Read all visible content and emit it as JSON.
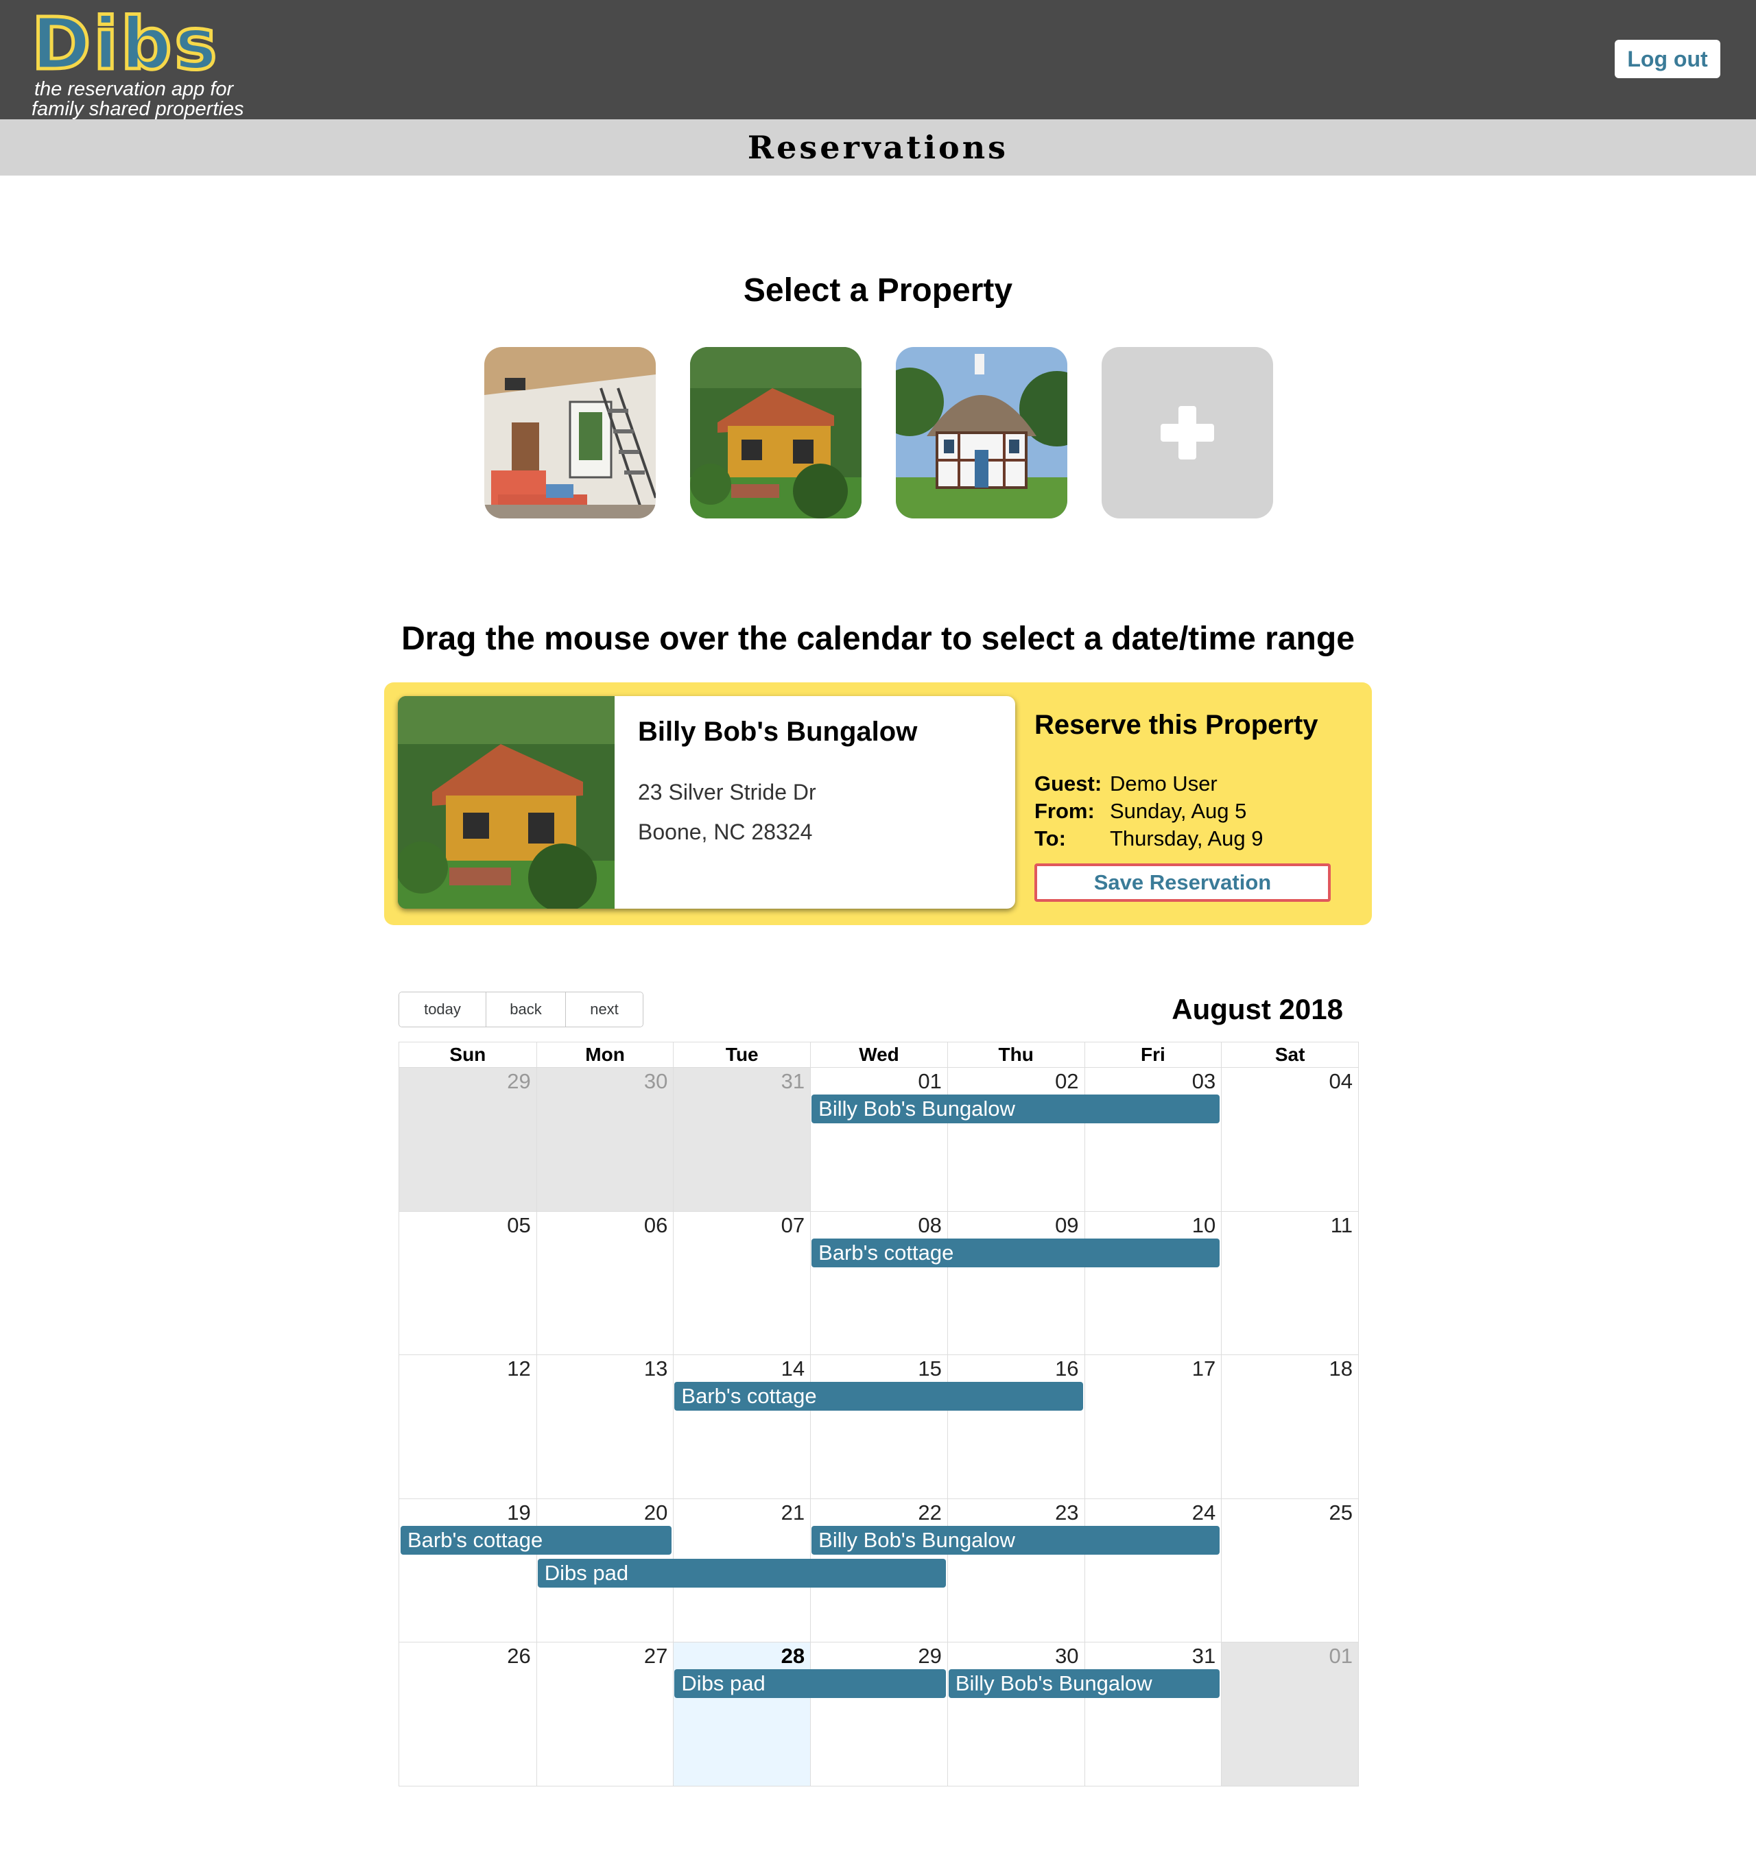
{
  "header": {
    "logo_text": "Dibs",
    "tagline_1": "the reservation app for",
    "tagline_2": "family shared properties",
    "logout_label": "Log out"
  },
  "page_title": "Reservations",
  "select_heading": "Select a Property",
  "drag_heading": "Drag the mouse over the calendar to select a date/time range",
  "selected_property": {
    "name": "Billy Bob's Bungalow",
    "address_1": "23 Silver Stride Dr",
    "address_2": "Boone, NC 28324"
  },
  "reserve": {
    "title": "Reserve this Property",
    "guest_label": "Guest:",
    "guest_value": "Demo User",
    "from_label": "From:",
    "from_value": "Sunday, Aug 5",
    "to_label": "To:",
    "to_value": "Thursday, Aug 9",
    "save_label": "Save Reservation"
  },
  "calendar": {
    "toolbar": {
      "today": "today",
      "back": "back",
      "next": "next"
    },
    "month_label": "August 2018",
    "weekdays": [
      "Sun",
      "Mon",
      "Tue",
      "Wed",
      "Thu",
      "Fri",
      "Sat"
    ],
    "weeks": [
      [
        {
          "d": "29",
          "off": true
        },
        {
          "d": "30",
          "off": true
        },
        {
          "d": "31",
          "off": true
        },
        {
          "d": "01"
        },
        {
          "d": "02"
        },
        {
          "d": "03"
        },
        {
          "d": "04"
        }
      ],
      [
        {
          "d": "05"
        },
        {
          "d": "06"
        },
        {
          "d": "07"
        },
        {
          "d": "08"
        },
        {
          "d": "09"
        },
        {
          "d": "10"
        },
        {
          "d": "11"
        }
      ],
      [
        {
          "d": "12"
        },
        {
          "d": "13"
        },
        {
          "d": "14"
        },
        {
          "d": "15"
        },
        {
          "d": "16"
        },
        {
          "d": "17"
        },
        {
          "d": "18"
        }
      ],
      [
        {
          "d": "19"
        },
        {
          "d": "20"
        },
        {
          "d": "21"
        },
        {
          "d": "22"
        },
        {
          "d": "23"
        },
        {
          "d": "24"
        },
        {
          "d": "25"
        }
      ],
      [
        {
          "d": "26"
        },
        {
          "d": "27"
        },
        {
          "d": "28",
          "today": true
        },
        {
          "d": "29"
        },
        {
          "d": "30"
        },
        {
          "d": "31"
        },
        {
          "d": "01",
          "off": true
        }
      ]
    ],
    "events": [
      {
        "title": "Billy Bob's Bungalow",
        "week": 0,
        "start": 3,
        "end": 5,
        "lane": 0
      },
      {
        "title": "Barb's cottage",
        "week": 1,
        "start": 3,
        "end": 5,
        "lane": 0
      },
      {
        "title": "Barb's cottage",
        "week": 2,
        "start": 2,
        "end": 4,
        "lane": 0
      },
      {
        "title": "Barb's cottage",
        "week": 3,
        "start": 0,
        "end": 1,
        "lane": 0
      },
      {
        "title": "Billy Bob's Bungalow",
        "week": 3,
        "start": 3,
        "end": 5,
        "lane": 0
      },
      {
        "title": "Dibs pad",
        "week": 3,
        "start": 1,
        "end": 3,
        "lane": 1
      },
      {
        "title": "Dibs pad",
        "week": 4,
        "start": 2,
        "end": 3,
        "lane": 0
      },
      {
        "title": "Billy Bob's Bungalow",
        "week": 4,
        "start": 4,
        "end": 5,
        "lane": 0
      }
    ]
  },
  "colors": {
    "header_bg": "#4a4a4a",
    "accent": "#3a7b98",
    "logo_yellow": "#f6d84a",
    "panel_yellow": "#fde363",
    "save_border": "#e0585c",
    "event_bg": "#3a7b98"
  }
}
